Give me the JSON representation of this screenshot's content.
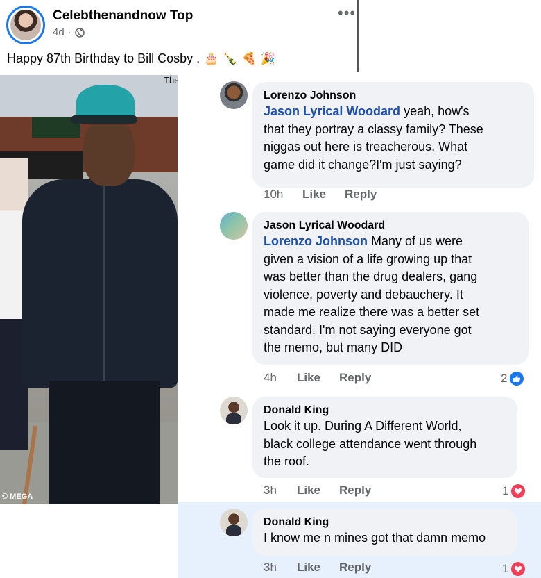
{
  "post": {
    "page_name": "Celebthenandnow Top",
    "age": "4d",
    "separator": "·",
    "more": "•••",
    "text": "Happy 87th Birthday to Bill Cosby .",
    "emojis": [
      "🎂",
      "🍾",
      "🍕",
      "🎉"
    ]
  },
  "photo": {
    "watermark": "© MEGA",
    "corner_text": "The"
  },
  "comments": [
    {
      "author": "Lorenzo Johnson",
      "mention": "Jason Lyrical Woodard",
      "lines": [
        " yeah, how's",
        "that they portray a classy family? These",
        "niggas out here is treacherous. What",
        "game did it change?I'm just saying?"
      ],
      "time": "10h",
      "like": "Like",
      "reply": "Reply"
    },
    {
      "author": "Jason Lyrical Woodard",
      "mention": "Lorenzo Johnson",
      "lines": [
        " Many of us were",
        "given a vision of a life growing up that",
        "was better than the drug dealers, gang",
        "violence, poverty and debauchery.  It",
        "made me realize there was a better set",
        "standard.  I'm not saying everyone got",
        "the memo, but many DID"
      ],
      "time": "4h",
      "like": "Like",
      "reply": "Reply",
      "reaction_count": "2",
      "reaction_type": "like"
    },
    {
      "author": "Donald King",
      "lines": [
        "Look it up. During A Different World,",
        "black college attendance went through",
        "the roof."
      ],
      "time": "3h",
      "like": "Like",
      "reply": "Reply",
      "reaction_count": "1",
      "reaction_type": "love"
    },
    {
      "author": "Donald King",
      "lines": [
        "I know me n mines got that damn memo"
      ],
      "time": "3h",
      "like": "Like",
      "reply": "Reply",
      "reaction_count": "1",
      "reaction_type": "love"
    }
  ],
  "colors": {
    "mention": "#1d4fae",
    "bubble": "#f0f2f5",
    "highlight": "#e7f0fd",
    "like_blue": "#1877f2",
    "love_red": "#f33e58"
  }
}
